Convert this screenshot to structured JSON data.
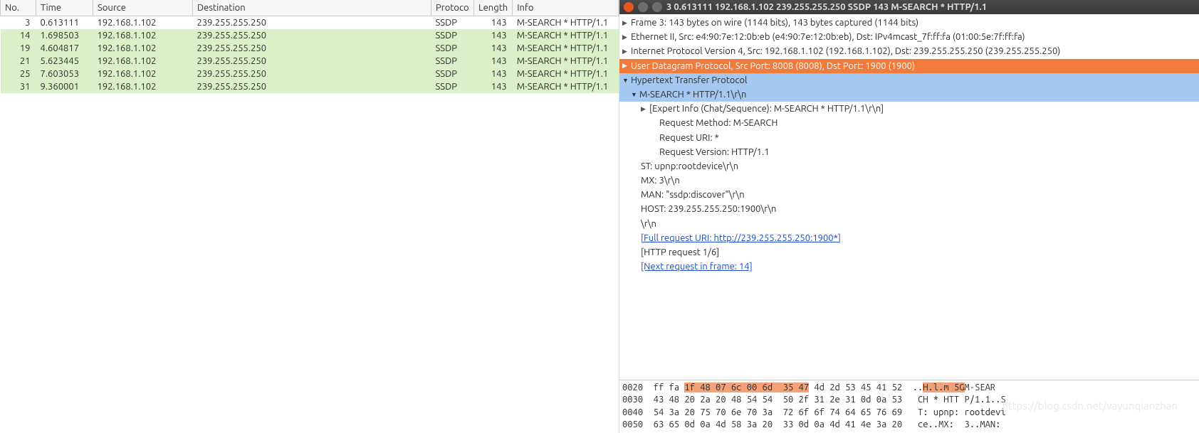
{
  "packet_list": {
    "headers": [
      "No.",
      "Time",
      "Source",
      "Destination",
      "Protoco",
      "Length",
      "Info"
    ],
    "rows": [
      {
        "no": "3",
        "time": "0.613111",
        "src": "192.168.1.102",
        "dst": "239.255.255.250",
        "proto": "SSDP",
        "len": "143",
        "info": "M-SEARCH * HTTP/1.1",
        "first": true
      },
      {
        "no": "14",
        "time": "1.698503",
        "src": "192.168.1.102",
        "dst": "239.255.255.250",
        "proto": "SSDP",
        "len": "143",
        "info": "M-SEARCH * HTTP/1.1"
      },
      {
        "no": "19",
        "time": "4.604817",
        "src": "192.168.1.102",
        "dst": "239.255.255.250",
        "proto": "SSDP",
        "len": "143",
        "info": "M-SEARCH * HTTP/1.1"
      },
      {
        "no": "21",
        "time": "5.623445",
        "src": "192.168.1.102",
        "dst": "239.255.255.250",
        "proto": "SSDP",
        "len": "143",
        "info": "M-SEARCH * HTTP/1.1"
      },
      {
        "no": "25",
        "time": "7.603053",
        "src": "192.168.1.102",
        "dst": "239.255.255.250",
        "proto": "SSDP",
        "len": "143",
        "info": "M-SEARCH * HTTP/1.1"
      },
      {
        "no": "31",
        "time": "9.360001",
        "src": "192.168.1.102",
        "dst": "239.255.255.250",
        "proto": "SSDP",
        "len": "143",
        "info": "M-SEARCH * HTTP/1.1"
      }
    ]
  },
  "detail_window": {
    "title": "3 0.613111 192.168.1.102 239.255.255.250 SSDP 143 M-SEARCH * HTTP/1.1",
    "tree": {
      "frame": "Frame 3: 143 bytes on wire (1144 bits), 143 bytes captured (1144 bits)",
      "eth": "Ethernet II, Src: e4:90:7e:12:0b:eb (e4:90:7e:12:0b:eb), Dst: IPv4mcast_7f:ff:fa (01:00:5e:7f:ff:fa)",
      "ip": "Internet Protocol Version 4, Src: 192.168.1.102 (192.168.1.102), Dst: 239.255.255.250 (239.255.255.250)",
      "udp": "User Datagram Protocol, Src Port: 8008 (8008), Dst Port: 1900 (1900)",
      "http": "Hypertext Transfer Protocol",
      "msearch": "M-SEARCH * HTTP/1.1\\r\\n",
      "expert": "[Expert Info (Chat/Sequence): M-SEARCH * HTTP/1.1\\r\\n]",
      "req_method": "Request Method: M-SEARCH",
      "req_uri": "Request URI: *",
      "req_ver": "Request Version: HTTP/1.1",
      "st": "ST: upnp:rootdevice\\r\\n",
      "mx": "MX: 3\\r\\n",
      "man": "MAN: \"ssdp:discover\"\\r\\n",
      "host": "HOST: 239.255.255.250:1900\\r\\n",
      "crlf": "\\r\\n",
      "full_uri": "[Full request URI: http://239.255.255.250:1900*]",
      "req_count": "[HTTP request 1/6]",
      "next_req": "[Next request in frame: 14]"
    }
  },
  "hex": {
    "r0_off": "0020",
    "r0_pre": "ff fa ",
    "r0_hl": "1f 48 07 6c 00 6d  35 47",
    "r0_post": " 4d 2d 53 45 41 52",
    "r0_apre": "  ..",
    "r0_ahl": "H.l.m 5G",
    "r0_apost": "M-SEAR",
    "r1": "0030  43 48 20 2a 20 48 54 54  50 2f 31 2e 31 0d 0a 53   CH * HTT P/1.1..S",
    "r2": "0040  54 3a 20 75 70 6e 70 3a  72 6f 6f 74 64 65 76 69   T: upnp: rootdevi",
    "r3": "0050  63 65 0d 0a 4d 58 3a 20  33 0d 0a 4d 41 4e 3a 20   ce..MX:  3..MAN: "
  },
  "watermark": "https://blog.csdn.net/vayunqianzhan"
}
